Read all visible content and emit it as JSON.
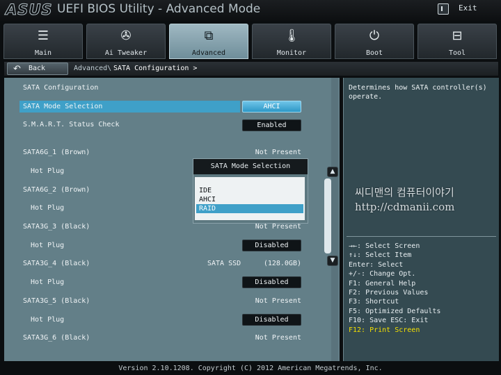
{
  "header": {
    "brand": "ASUS",
    "title": "UEFI BIOS Utility - Advanced Mode",
    "exit_label": "Exit"
  },
  "tabs": [
    {
      "label": "Main",
      "icon": "list-icon"
    },
    {
      "label": "Ai Tweaker",
      "icon": "fan-icon"
    },
    {
      "label": "Advanced",
      "icon": "advanced-icon",
      "active": true
    },
    {
      "label": "Monitor",
      "icon": "thermometer-icon"
    },
    {
      "label": "Boot",
      "icon": "power-icon"
    },
    {
      "label": "Tool",
      "icon": "toolbox-icon"
    }
  ],
  "breadcrumb": {
    "back_label": "Back",
    "parent": "Advanced\\",
    "current": "SATA Configuration >"
  },
  "main": {
    "section_title": "SATA Configuration",
    "sata_mode_label": "SATA Mode Selection",
    "sata_mode_value": "AHCI",
    "smart_label": "S.M.A.R.T. Status Check",
    "smart_value": "Enabled",
    "ports": [
      {
        "label": "SATA6G_1 (Brown)",
        "status": "Not Present"
      },
      {
        "label": "SATA6G_2 (Brown)",
        "status": ""
      },
      {
        "label": "SATA3G_3 (Black)",
        "status": "Not Present"
      },
      {
        "label": "SATA3G_4 (Black)",
        "device": "SATA SSD",
        "size": "(128.0GB)"
      },
      {
        "label": "SATA3G_5 (Black)",
        "status": "Not Present"
      },
      {
        "label": "SATA3G_6 (Black)",
        "status": "Not Present"
      }
    ],
    "hot_plug_label": "Hot Plug",
    "hot_plug_values": [
      "Disabled",
      "Disabled",
      "Disabled",
      "Disabled"
    ]
  },
  "popup": {
    "title": "SATA Mode Selection",
    "options": [
      "IDE",
      "AHCI",
      "RAID"
    ],
    "highlighted": "RAID"
  },
  "help": {
    "description": "Determines how SATA controller(s)\noperate.",
    "keys": [
      "→←: Select Screen",
      "↑↓: Select Item",
      "Enter: Select",
      "+/-: Change Opt.",
      "F1: General Help",
      "F2: Previous Values",
      "F3: Shortcut",
      "F5: Optimized Defaults",
      "F10: Save  ESC: Exit",
      "F12: Print Screen"
    ]
  },
  "watermark": {
    "line1": "씨디맨의 컴퓨터이야기",
    "line2": "http://cdmanii.com"
  },
  "footer": {
    "text": "Version 2.10.1208. Copyright (C) 2012 American Megatrends, Inc."
  },
  "colors": {
    "accent": "#3fa0c8",
    "panel": "#637f88",
    "help_panel": "#344a51",
    "f12_key": "#f4e000"
  }
}
